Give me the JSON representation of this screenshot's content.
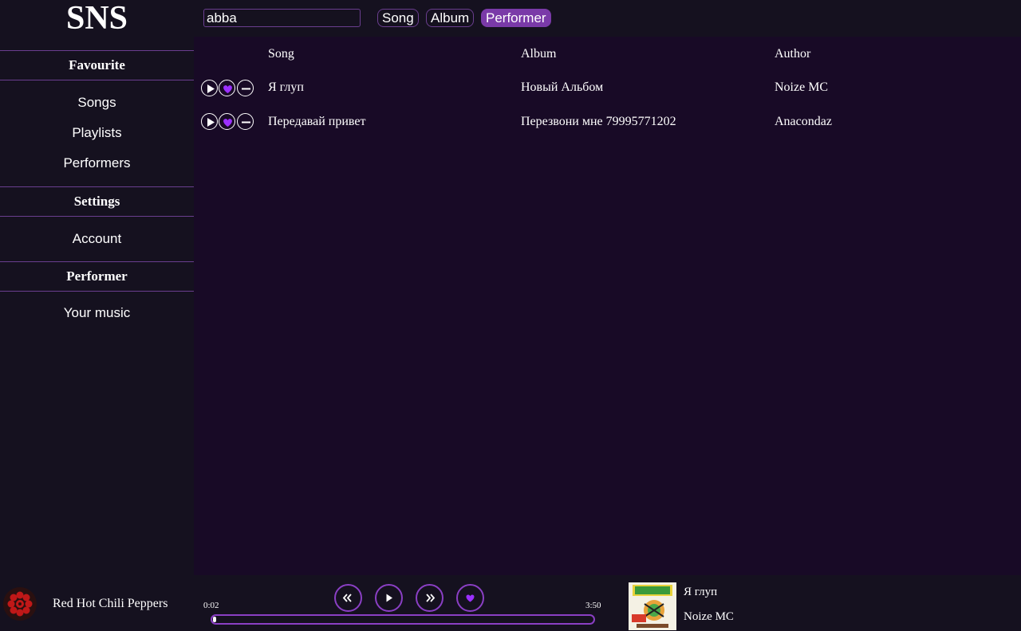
{
  "app": {
    "logo": "SNS"
  },
  "sidebar": {
    "sections": [
      {
        "title": "Favourite",
        "items": [
          "Songs",
          "Playlists",
          "Performers"
        ]
      },
      {
        "title": "Settings",
        "items": [
          "Account"
        ]
      },
      {
        "title": "Performer",
        "items": [
          "Your music"
        ]
      }
    ]
  },
  "search": {
    "value": "abba"
  },
  "filters": [
    {
      "label": "Song",
      "active": false
    },
    {
      "label": "Album",
      "active": false
    },
    {
      "label": "Performer",
      "active": true
    }
  ],
  "table": {
    "columns": [
      "Song",
      "Album",
      "Author"
    ],
    "rows": [
      {
        "song": "Я глуп",
        "album": "Новый Альбом",
        "author": "Noize MC"
      },
      {
        "song": "Передавай привет",
        "album": "Перезвони мне 79995771202",
        "author": "Anacondaz"
      }
    ],
    "row_icons": [
      "play-icon",
      "heart-icon",
      "minus-icon"
    ]
  },
  "player": {
    "artist": "Red Hot Chili Peppers",
    "current_time": "0:02",
    "total_time": "3:50",
    "progress": 0.009,
    "controls": [
      "rewind-icon",
      "play-icon",
      "fast-forward-icon",
      "heart-icon"
    ],
    "track": {
      "title": "Я глуп",
      "artist": "Noize MC"
    }
  },
  "colors": {
    "accent": "#8a3fc4",
    "active_filter": "#7a3aa8",
    "heart": "#9b30ff",
    "sidebar_bg": "#15111f",
    "main_bg": "#180a26"
  }
}
